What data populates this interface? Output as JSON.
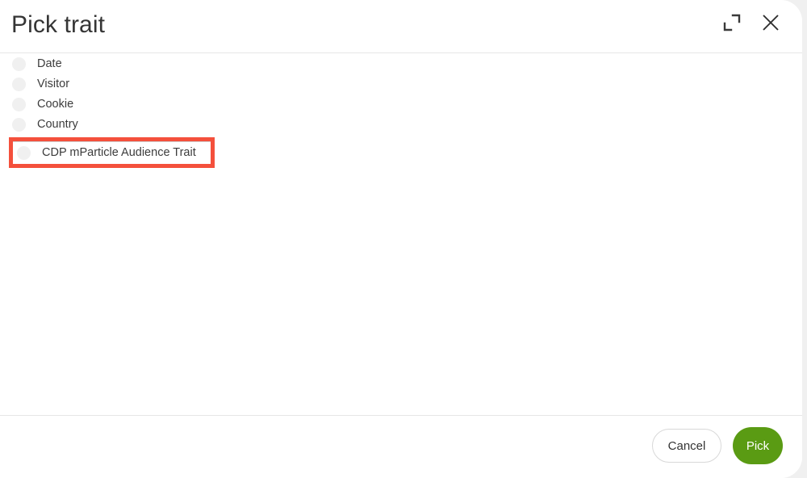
{
  "dialog": {
    "title": "Pick trait",
    "header_icons": [
      {
        "name": "expand-icon",
        "label": "Expand"
      },
      {
        "name": "close-icon",
        "label": "Close"
      }
    ]
  },
  "list": {
    "items": [
      {
        "label": "Date",
        "selected": false,
        "highlighted": false
      },
      {
        "label": "Visitor",
        "selected": false,
        "highlighted": false
      },
      {
        "label": "Cookie",
        "selected": false,
        "highlighted": false
      },
      {
        "label": "Country",
        "selected": false,
        "highlighted": false
      },
      {
        "label": "CDP mParticle Audience Trait",
        "selected": false,
        "highlighted": true
      }
    ]
  },
  "footer": {
    "cancel_label": "Cancel",
    "pick_label": "Pick"
  },
  "colors": {
    "accent_green": "#5a9b13",
    "annotation_red": "#f4503c",
    "radio_gray": "#f0f0f0",
    "text_dark": "#353535",
    "divider": "#e6e6e6",
    "backdrop": "#f0f0f0"
  }
}
